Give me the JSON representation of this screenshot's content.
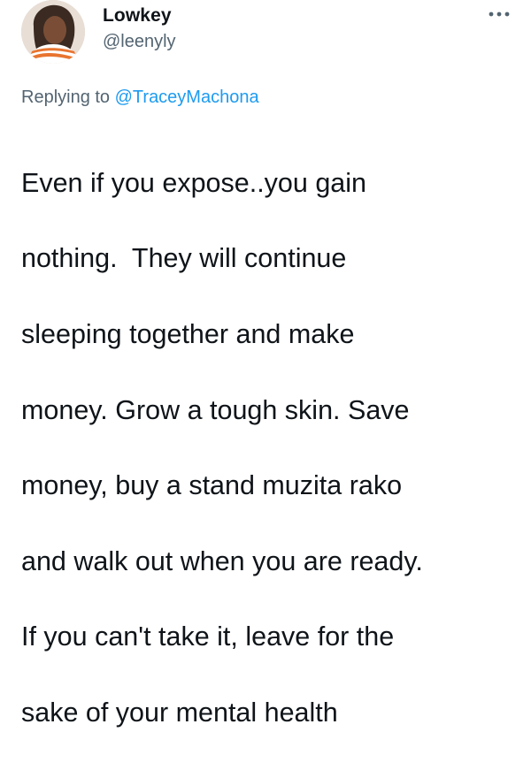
{
  "author": {
    "display_name": "Lowkey",
    "handle": "@leenyly",
    "avatar_icon": "profile-photo"
  },
  "menu": {
    "icon": "more-horizontal-icon"
  },
  "reply": {
    "prefix": "Replying to ",
    "to_handle": "@TraceyMachona"
  },
  "tweet": {
    "text_lines": [
      "Even if you expose..you gain",
      "nothing.  They will continue",
      "sleeping together and make",
      "money. Grow a tough skin. Save",
      "money, buy a stand muzita rako",
      "and walk out when you are ready.",
      "If you can't take it, leave for the",
      "sake of your mental health"
    ]
  },
  "colors": {
    "text_primary": "#0f1419",
    "text_secondary": "#536471",
    "link": "#1d9bf0"
  }
}
